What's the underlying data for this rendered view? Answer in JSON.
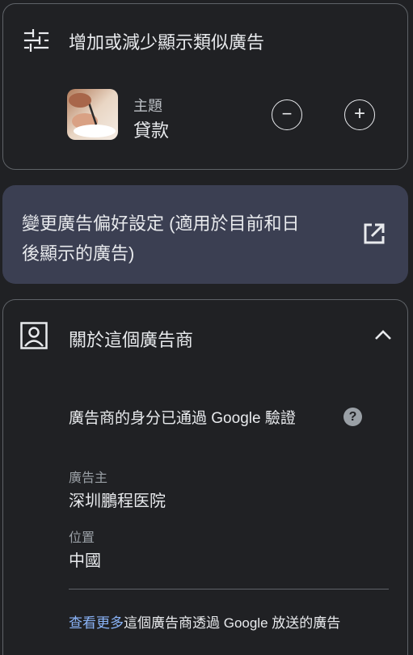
{
  "similar_ads": {
    "title": "增加或減少顯示類似廣告",
    "topic_label": "主題",
    "topic_value": "貸款",
    "decrease_symbol": "−",
    "increase_symbol": "+"
  },
  "preferences": {
    "line1": "變更廣告偏好設定 (適用於目前和日",
    "line2": "後顯示的廣告)"
  },
  "advertiser": {
    "title": "關於這個廣告商",
    "verified_text": "廣告商的身分已通過 Google 驗證",
    "advertiser_label": "廣告主",
    "advertiser_value": "深圳鵬程医院",
    "location_label": "位置",
    "location_value": "中國",
    "see_more_link": "查看更多",
    "see_more_rest": "這個廣告商透過 Google 放送的廣告"
  },
  "colors": {
    "background": "#202124",
    "prefs_card": "#3b3f52",
    "link": "#8ab4f8"
  }
}
